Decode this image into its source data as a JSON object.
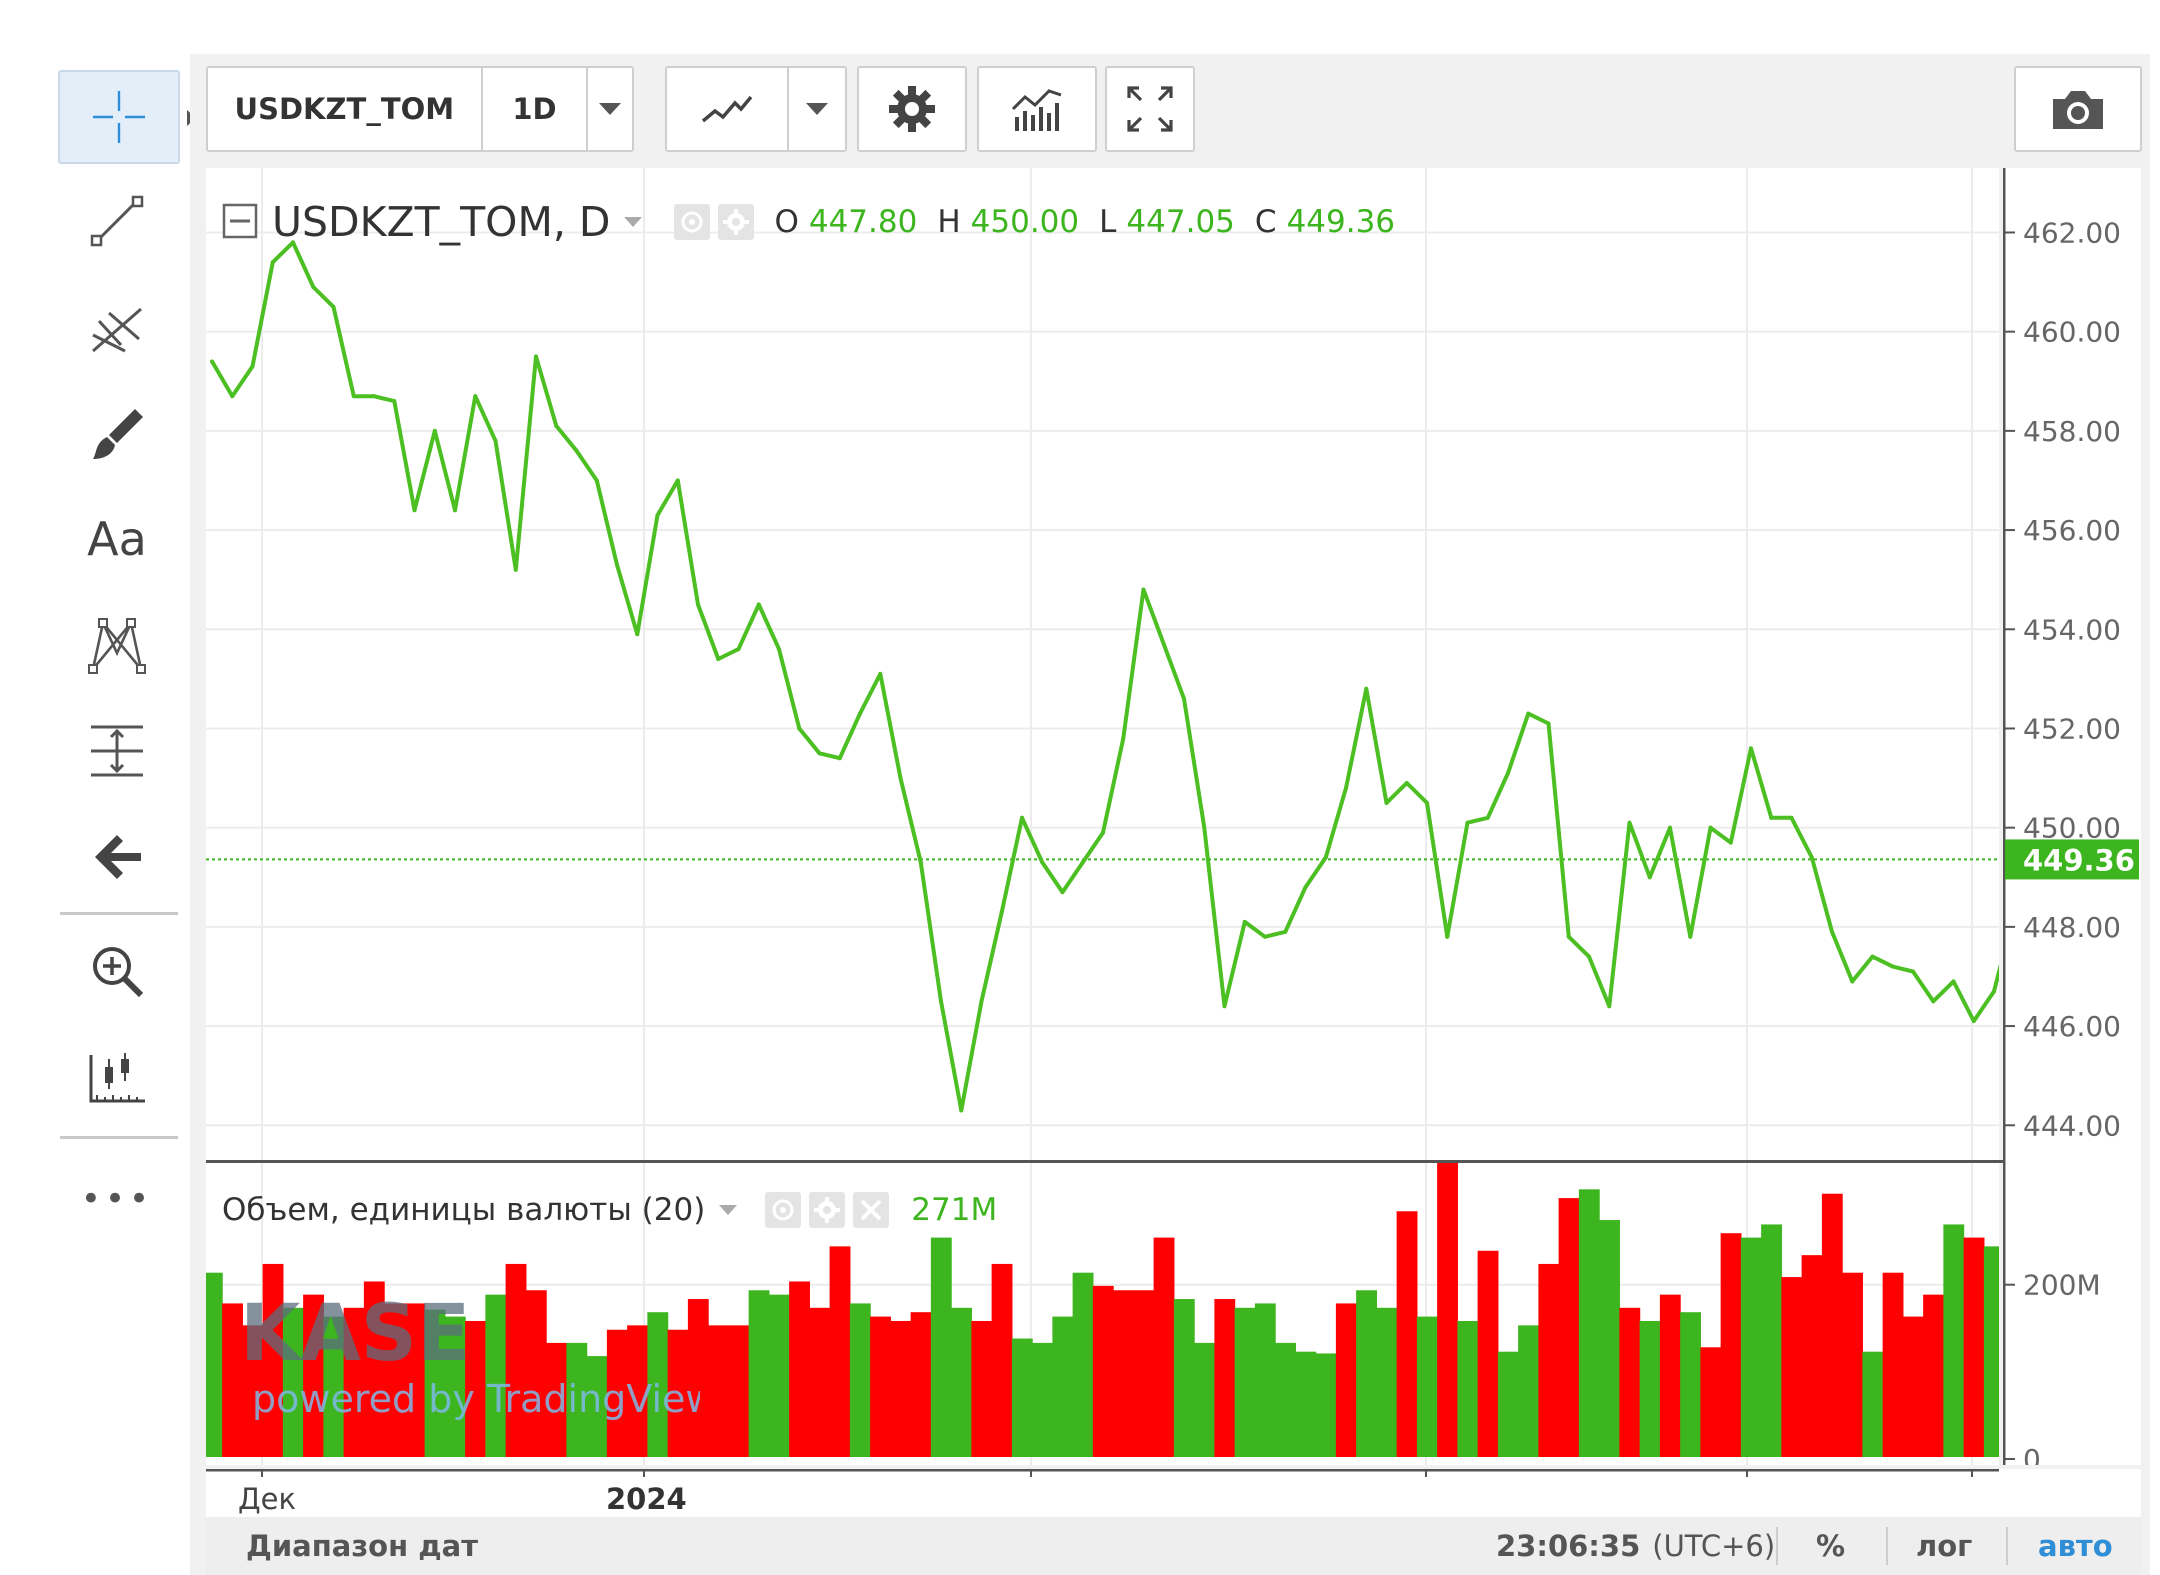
{
  "toolbar": {
    "symbol": "USDKZT_TOM",
    "interval": "1D"
  },
  "left_toolbar": {
    "tools": [
      "crosshair",
      "trend-line",
      "pitchfork",
      "brush",
      "text",
      "pattern",
      "measure",
      "back",
      "zoom",
      "position"
    ],
    "text_tool_label": "Aa",
    "more_label": "•••"
  },
  "legend": {
    "symbol": "USDKZT_TOM, D",
    "o_label": "O",
    "o_value": "447.80",
    "h_label": "H",
    "h_value": "450.00",
    "l_label": "L",
    "l_value": "447.05",
    "c_label": "C",
    "c_value": "449.36"
  },
  "volume_legend": {
    "title": "Объем, единицы валюты (20)",
    "value": "271M"
  },
  "watermark": {
    "brand": "KASE",
    "powered": "powered by TradingView"
  },
  "status_bar": {
    "date_range": "Диапазон дат",
    "time": "23:06:35",
    "timezone": "(UTC+6)",
    "percent": "%",
    "log": "лог",
    "auto": "авто"
  },
  "colors": {
    "line": "#4cbf22",
    "up": "#3db51e",
    "down": "#ff0000",
    "last_price_bg": "#3db51e",
    "auto_text": "#2f8ed6"
  },
  "chart_data": [
    {
      "type": "line",
      "title": "USDKZT_TOM, D",
      "x_tick_labels": [
        "Дек",
        "2024"
      ],
      "y_ticks": [
        "444.00",
        "446.00",
        "448.00",
        "450.00",
        "452.00",
        "454.00",
        "456.00",
        "458.00",
        "460.00",
        "462.00"
      ],
      "ylim": [
        443.3,
        463.3
      ],
      "last_price": "449.36",
      "x": [
        0,
        1,
        2,
        3,
        4,
        5,
        6,
        7,
        8,
        9,
        10,
        11,
        12,
        13,
        14,
        15,
        16,
        17,
        18,
        19,
        20,
        21,
        22,
        23,
        24,
        25,
        26,
        27,
        28,
        29,
        30,
        31,
        32,
        33,
        34,
        35,
        36,
        37,
        38,
        39,
        40,
        41,
        42,
        43,
        44,
        45,
        46,
        47,
        48,
        49,
        50,
        51,
        52,
        53,
        54,
        55,
        56,
        57,
        58,
        59,
        60,
        61,
        62,
        63,
        64,
        65,
        66,
        67,
        68,
        69,
        70,
        71,
        72,
        73,
        74,
        75,
        76,
        77,
        78,
        79,
        80,
        81,
        82,
        83,
        84,
        85,
        86,
        87,
        88,
        89,
        90,
        91,
        92
      ],
      "values": [
        459.4,
        458.7,
        459.3,
        461.4,
        461.8,
        460.9,
        460.5,
        458.7,
        458.7,
        458.6,
        456.4,
        458.0,
        456.4,
        458.7,
        457.8,
        455.2,
        459.5,
        458.1,
        457.6,
        457.0,
        455.3,
        453.9,
        456.3,
        457.0,
        454.5,
        453.4,
        453.6,
        454.5,
        453.6,
        452.0,
        451.5,
        451.4,
        452.3,
        453.1,
        451.0,
        449.3,
        446.5,
        444.3,
        446.5,
        448.3,
        450.2,
        449.3,
        448.7,
        449.3,
        449.9,
        451.8,
        454.8,
        453.7,
        452.6,
        450.0,
        446.4,
        448.1,
        447.8,
        447.9,
        448.8,
        449.4,
        450.8,
        452.8,
        450.5,
        450.9,
        450.5,
        447.8,
        450.1,
        450.2,
        451.1,
        452.3,
        452.1,
        447.8,
        447.4,
        446.4,
        450.1,
        449.0,
        450.0,
        447.8,
        450.0,
        449.7,
        451.6,
        450.2,
        450.2,
        449.4,
        447.9,
        446.9,
        447.4,
        447.2,
        447.1,
        446.5,
        446.9,
        446.1,
        446.7,
        448.3,
        447.6,
        449.36
      ]
    },
    {
      "type": "bar",
      "title": "Объем, единицы валюты (20)",
      "y_ticks": [
        "0",
        "200M"
      ],
      "ylim": [
        0,
        335
      ],
      "units": "M",
      "values": [
        210,
        175,
        150,
        220,
        170,
        185,
        160,
        170,
        200,
        175,
        175,
        168,
        160,
        155,
        185,
        220,
        190,
        130,
        130,
        115,
        145,
        150,
        165,
        145,
        180,
        150,
        150,
        190,
        185,
        200,
        170,
        240,
        175,
        160,
        155,
        165,
        250,
        170,
        155,
        220,
        135,
        130,
        160,
        210,
        195,
        190,
        190,
        250,
        180,
        130,
        180,
        170,
        175,
        130,
        120,
        118,
        175,
        190,
        170,
        280,
        160,
        335,
        155,
        235,
        120,
        150,
        220,
        295,
        305,
        270,
        170,
        155,
        185,
        165,
        125,
        255,
        250,
        265,
        205,
        230,
        300,
        210,
        120,
        210,
        160,
        185,
        265,
        250,
        240,
        150,
        255,
        265
      ],
      "up": [
        1,
        0,
        0,
        0,
        1,
        0,
        1,
        0,
        0,
        0,
        0,
        1,
        1,
        0,
        1,
        0,
        0,
        0,
        1,
        1,
        0,
        0,
        1,
        0,
        0,
        0,
        0,
        1,
        1,
        0,
        0,
        0,
        1,
        0,
        0,
        0,
        1,
        1,
        0,
        0,
        1,
        1,
        1,
        1,
        0,
        0,
        0,
        0,
        1,
        1,
        0,
        1,
        1,
        1,
        1,
        1,
        0,
        1,
        1,
        0,
        1,
        0,
        1,
        0,
        1,
        1,
        0,
        0,
        1,
        1,
        0,
        1,
        0,
        1,
        0,
        0,
        1,
        1,
        0,
        0,
        0,
        0,
        1,
        0,
        0,
        0,
        1,
        0,
        1,
        1,
        0,
        1
      ]
    }
  ]
}
